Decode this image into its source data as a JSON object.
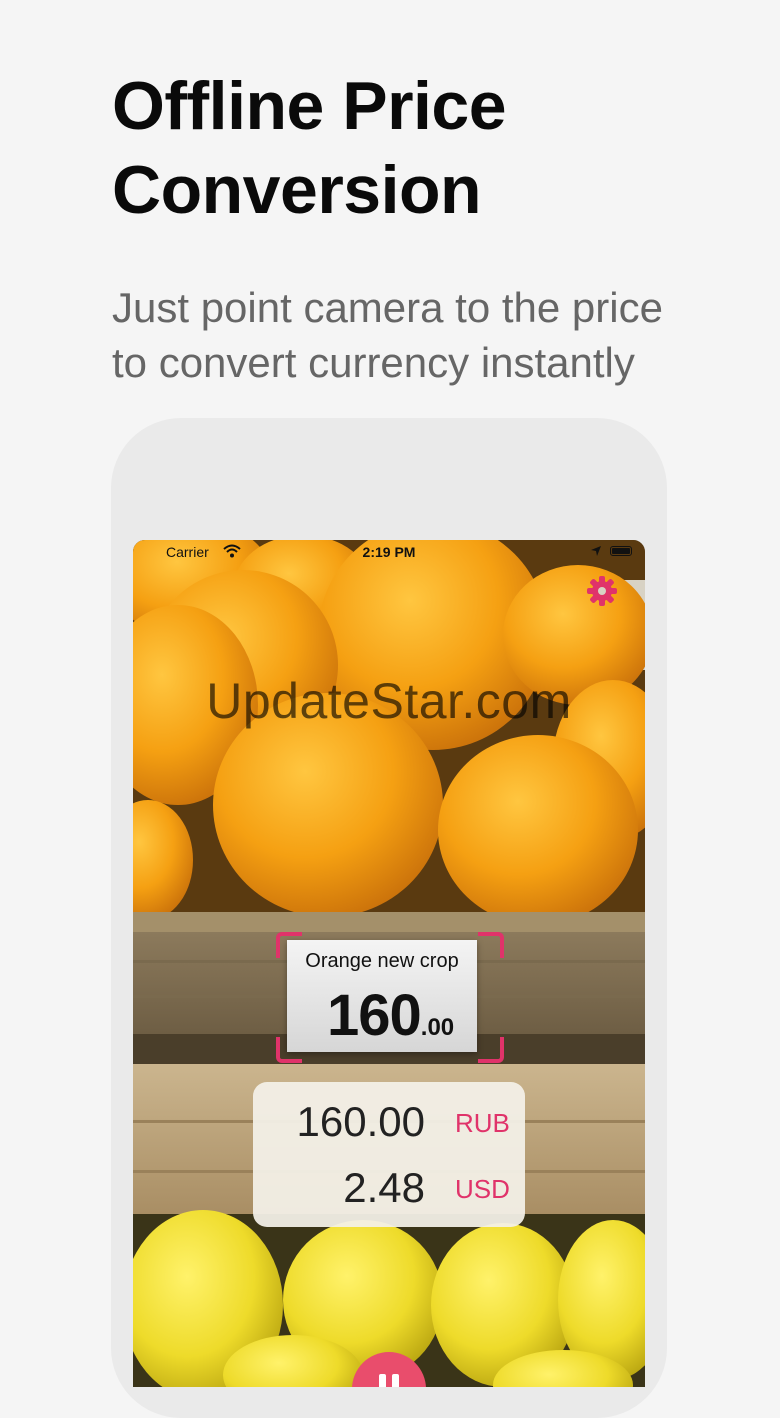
{
  "headline": {
    "line1": "Offline Price",
    "line2": "Conversion"
  },
  "subheadline": {
    "line1": "Just point camera to the price",
    "line2": "to convert currency instantly"
  },
  "status_bar": {
    "carrier": "Carrier",
    "time": "2:19 PM"
  },
  "watermark": "UpdateStar.com",
  "price_tag": {
    "name": "Orange new crop",
    "price_main": "160",
    "price_cents": ".00"
  },
  "conversion": [
    {
      "amount": "160.00",
      "currency": "RUB"
    },
    {
      "amount": "2.48",
      "currency": "USD"
    }
  ],
  "colors": {
    "accent": "#e0336a",
    "background": "#f5f5f5",
    "headline": "#0a0a0a",
    "subheadline": "#666666"
  },
  "icons": {
    "settings": "gear-icon",
    "pause": "pause-icon",
    "wifi": "wifi-icon",
    "location": "location-arrow-icon",
    "battery": "battery-icon"
  }
}
